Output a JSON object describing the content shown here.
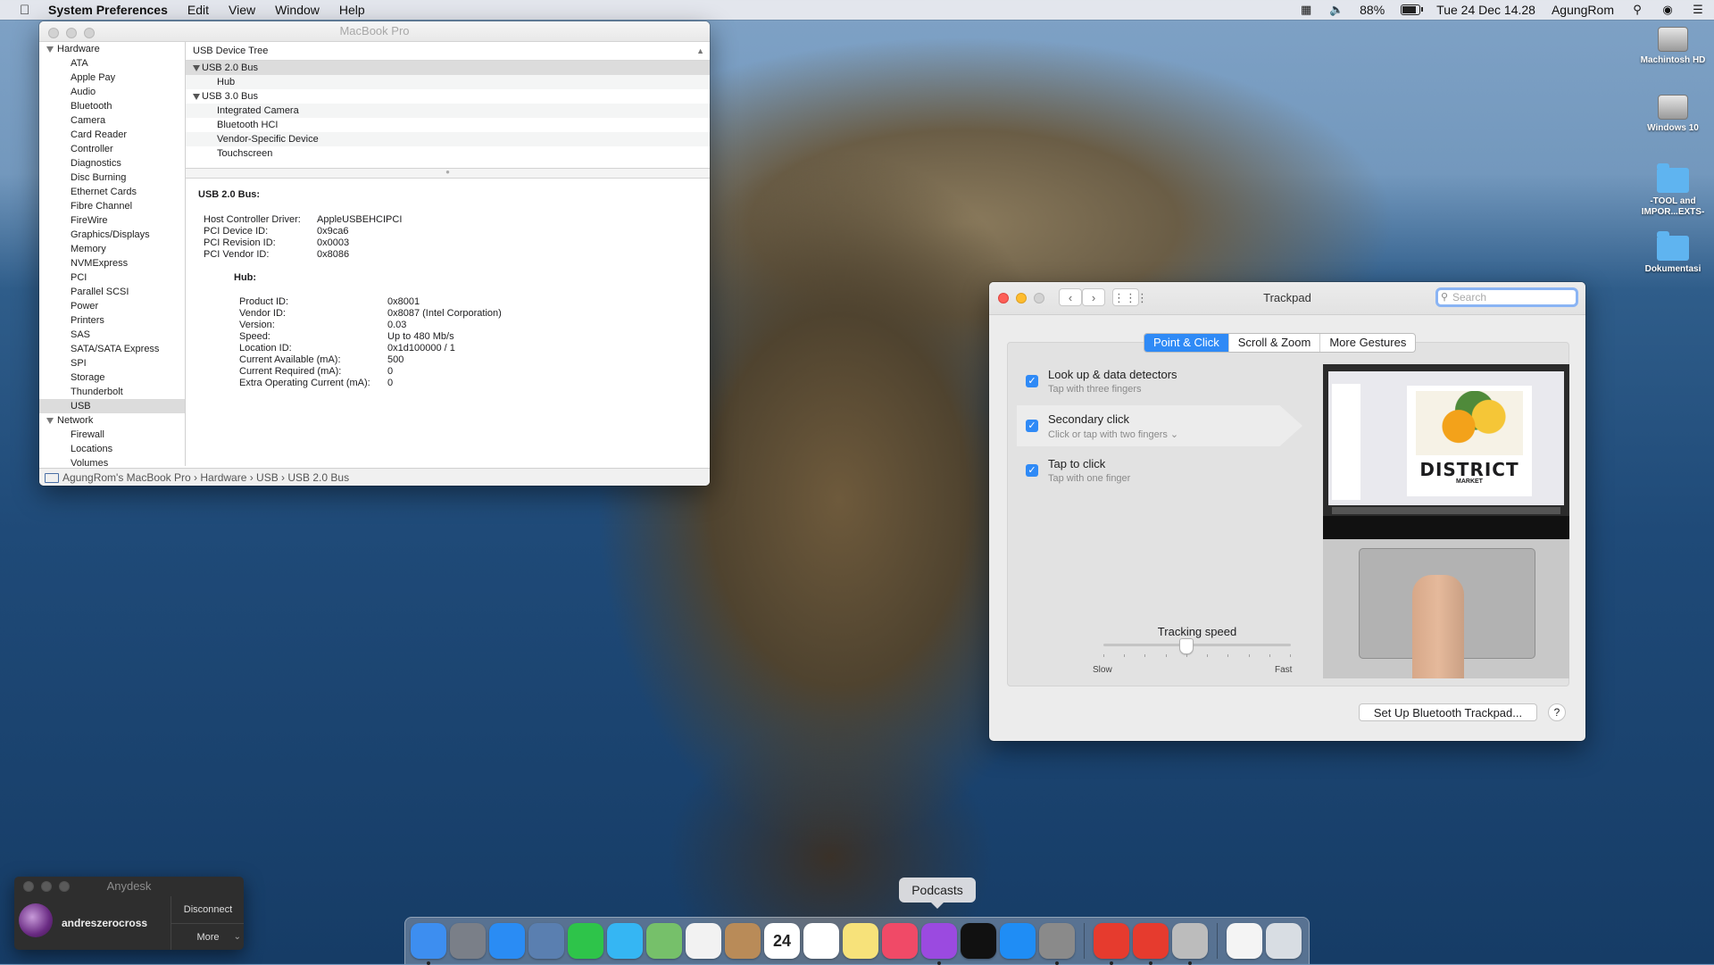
{
  "menubar": {
    "app_name": "System Preferences",
    "menus": [
      "Edit",
      "View",
      "Window",
      "Help"
    ],
    "battery_percent": "88%",
    "battery_level": 0.88,
    "datetime": "Tue 24 Dec  14.28",
    "user": "AgungRom"
  },
  "desktop": {
    "icons": [
      {
        "label": "Machintosh HD",
        "kind": "drive"
      },
      {
        "label": "Windows 10",
        "kind": "drive"
      },
      {
        "label": "-TOOL and IMPOR...EXTS-",
        "kind": "folder"
      },
      {
        "label": "Dokumentasi",
        "kind": "folder"
      }
    ]
  },
  "sysinfo": {
    "title": "MacBook Pro",
    "sidebar": {
      "hardware_label": "Hardware",
      "hardware_items": [
        "ATA",
        "Apple Pay",
        "Audio",
        "Bluetooth",
        "Camera",
        "Card Reader",
        "Controller",
        "Diagnostics",
        "Disc Burning",
        "Ethernet Cards",
        "Fibre Channel",
        "FireWire",
        "Graphics/Displays",
        "Memory",
        "NVMExpress",
        "PCI",
        "Parallel SCSI",
        "Power",
        "Printers",
        "SAS",
        "SATA/SATA Express",
        "SPI",
        "Storage",
        "Thunderbolt",
        "USB"
      ],
      "selected": "USB",
      "network_label": "Network",
      "network_items": [
        "Firewall",
        "Locations",
        "Volumes"
      ]
    },
    "tree": {
      "header": "USB Device Tree",
      "bus1": "USB 2.0 Bus",
      "bus1_children": [
        "Hub"
      ],
      "bus2": "USB 3.0 Bus",
      "bus2_children": [
        "Integrated Camera",
        "Bluetooth HCI",
        "Vendor-Specific Device",
        "Touchscreen"
      ]
    },
    "detail": {
      "heading": "USB 2.0 Bus:",
      "controller": [
        {
          "k": "Host Controller Driver:",
          "v": "AppleUSBEHCIPCI"
        },
        {
          "k": "PCI Device ID:",
          "v": "0x9ca6"
        },
        {
          "k": "PCI Revision ID:",
          "v": "0x0003"
        },
        {
          "k": "PCI Vendor ID:",
          "v": "0x8086"
        }
      ],
      "hub_heading": "Hub:",
      "hub": [
        {
          "k": "Product ID:",
          "v": "0x8001"
        },
        {
          "k": "Vendor ID:",
          "v": "0x8087  (Intel Corporation)"
        },
        {
          "k": "Version:",
          "v": "0.03"
        },
        {
          "k": "Speed:",
          "v": "Up to 480 Mb/s"
        },
        {
          "k": "Location ID:",
          "v": "0x1d100000 / 1"
        },
        {
          "k": "Current Available (mA):",
          "v": "500"
        },
        {
          "k": "Current Required (mA):",
          "v": "0"
        },
        {
          "k": "Extra Operating Current (mA):",
          "v": "0"
        }
      ]
    },
    "path": "AgungRom's MacBook Pro  ›  Hardware  ›  USB  ›  USB 2.0 Bus"
  },
  "trackpad": {
    "title": "Trackpad",
    "search_placeholder": "Search",
    "tabs": [
      "Point & Click",
      "Scroll & Zoom",
      "More Gestures"
    ],
    "active_tab": "Point & Click",
    "options": [
      {
        "title": "Look up & data detectors",
        "subtitle": "Tap with three fingers",
        "checked": true
      },
      {
        "title": "Secondary click",
        "subtitle": "Click or tap with two fingers ⌄",
        "checked": true
      },
      {
        "title": "Tap to click",
        "subtitle": "Tap with one finger",
        "checked": true
      }
    ],
    "preview_brand": "DISTRICT",
    "preview_sub": "MARKET",
    "tracking_label": "Tracking speed",
    "tracking_min": "Slow",
    "tracking_max": "Fast",
    "tracking_value": 0.44,
    "setup_button": "Set Up Bluetooth Trackpad...",
    "help_button": "?"
  },
  "anydesk": {
    "title": "Anydesk",
    "user": "andreszerocross",
    "disconnect": "Disconnect",
    "more": "More"
  },
  "dock": {
    "tooltip": "Podcasts",
    "calendar_day": "24",
    "apps": [
      {
        "name": "Finder",
        "color": "#3d8ef0"
      },
      {
        "name": "Launchpad",
        "color": "#7a7f88"
      },
      {
        "name": "Safari",
        "color": "#2a8cf4"
      },
      {
        "name": "Preview",
        "color": "#5a7fb0"
      },
      {
        "name": "FaceTime",
        "color": "#2ec44a"
      },
      {
        "name": "Messages",
        "color": "#35b6f3"
      },
      {
        "name": "Maps",
        "color": "#76c06a"
      },
      {
        "name": "Photos",
        "color": "#f2f2f2"
      },
      {
        "name": "Contacts",
        "color": "#b98b58"
      },
      {
        "name": "Calendar",
        "color": "#ffffff"
      },
      {
        "name": "Reminders",
        "color": "#ffffff"
      },
      {
        "name": "Notes",
        "color": "#f7e27a"
      },
      {
        "name": "Music",
        "color": "#f04a67"
      },
      {
        "name": "Podcasts",
        "color": "#9b4ae0"
      },
      {
        "name": "TV",
        "color": "#111111"
      },
      {
        "name": "App Store",
        "color": "#1f8df5"
      },
      {
        "name": "System Preferences",
        "color": "#8a8a8a"
      },
      {
        "name": "AnyDesk",
        "color": "#e63b2e"
      },
      {
        "name": "AnyDesk 2",
        "color": "#e63b2e"
      },
      {
        "name": "USB Utility",
        "color": "#bcbcbc"
      },
      {
        "name": "Document",
        "color": "#f4f4f4"
      },
      {
        "name": "Trash",
        "color": "#d8dde3"
      }
    ]
  }
}
